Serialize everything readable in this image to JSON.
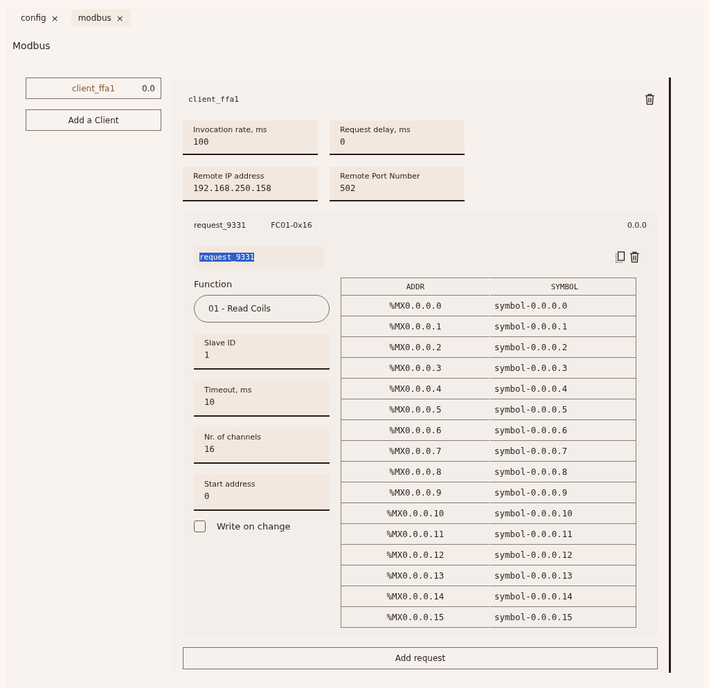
{
  "tabs": [
    {
      "label": "config",
      "close": "×",
      "selected": false
    },
    {
      "label": "modbus",
      "close": "×",
      "selected": true
    }
  ],
  "page_title": "Modbus",
  "clients": [
    {
      "name": "client_ffa1",
      "value": "0.0",
      "selected": true
    }
  ],
  "add_client_button": "Add a Client",
  "client": {
    "name": "client_ffa1",
    "fields": [
      {
        "label": "Invocation rate, ms",
        "value": "100"
      },
      {
        "label": "Request delay, ms",
        "value": "0"
      },
      {
        "label": "Remote IP address",
        "value": "192.168.250.158"
      },
      {
        "label": "Remote Port Number",
        "value": "502"
      }
    ],
    "request": {
      "name": "request_9331",
      "function_code": "FC01-0x16",
      "version": "0.0.0",
      "name_field": {
        "value": "request_9331",
        "text_selected": true
      },
      "function_label": "Function",
      "function_value": "01 - Read Coils",
      "fields": [
        {
          "label": "Slave ID",
          "value": "1"
        },
        {
          "label": "Timeout, ms",
          "value": "10"
        },
        {
          "label": "Nr. of channels",
          "value": "16"
        },
        {
          "label": "Start address",
          "value": "0"
        }
      ],
      "write_on_change": {
        "label": "Write on change",
        "checked": false
      },
      "table": {
        "columns": [
          "ADDR",
          "SYMBOL"
        ],
        "rows": [
          [
            "%MX0.0.0.0",
            "symbol-0.0.0.0"
          ],
          [
            "%MX0.0.0.1",
            "symbol-0.0.0.1"
          ],
          [
            "%MX0.0.0.2",
            "symbol-0.0.0.2"
          ],
          [
            "%MX0.0.0.3",
            "symbol-0.0.0.3"
          ],
          [
            "%MX0.0.0.4",
            "symbol-0.0.0.4"
          ],
          [
            "%MX0.0.0.5",
            "symbol-0.0.0.5"
          ],
          [
            "%MX0.0.0.6",
            "symbol-0.0.0.6"
          ],
          [
            "%MX0.0.0.7",
            "symbol-0.0.0.7"
          ],
          [
            "%MX0.0.0.8",
            "symbol-0.0.0.8"
          ],
          [
            "%MX0.0.0.9",
            "symbol-0.0.0.9"
          ],
          [
            "%MX0.0.0.10",
            "symbol-0.0.0.10"
          ],
          [
            "%MX0.0.0.11",
            "symbol-0.0.0.11"
          ],
          [
            "%MX0.0.0.12",
            "symbol-0.0.0.12"
          ],
          [
            "%MX0.0.0.13",
            "symbol-0.0.0.13"
          ],
          [
            "%MX0.0.0.14",
            "symbol-0.0.0.14"
          ],
          [
            "%MX0.0.0.15",
            "symbol-0.0.0.15"
          ]
        ]
      }
    },
    "add_request_button": "Add request"
  }
}
